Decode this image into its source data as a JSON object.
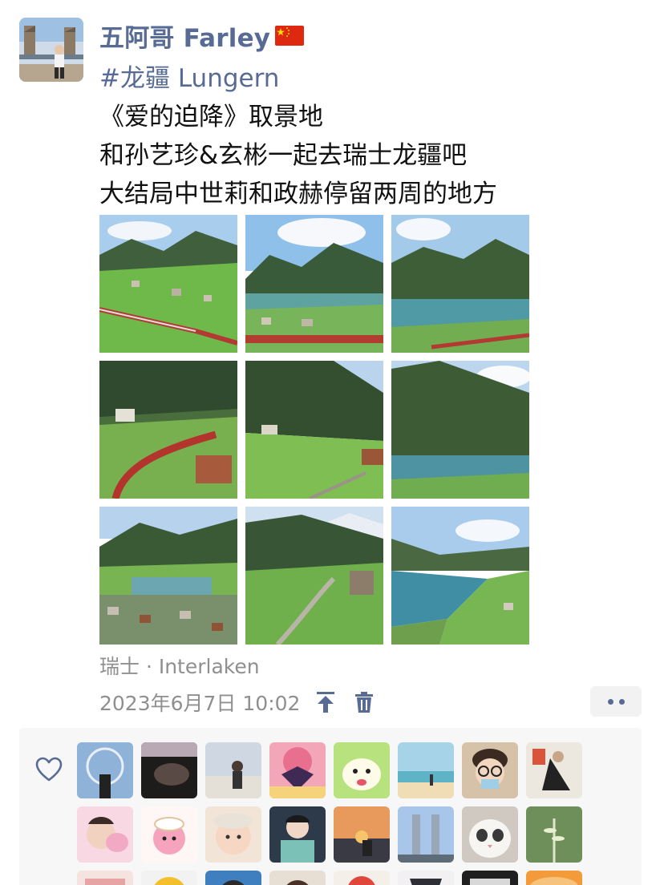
{
  "post": {
    "author": "五阿哥 Farley",
    "flag_icon": "china-flag-icon",
    "hashtag": "#龙疆 Lungern",
    "lines": [
      "《爱的迫降》取景地",
      "和孙艺珍&玄彬一起去瑞士龙疆吧",
      "大结局中世莉和政赫停留两周的地方"
    ],
    "location": "瑞士 · Interlaken",
    "timestamp": "2023年6月7日 10:02",
    "actions": {
      "pin_icon": "pin-to-top-icon",
      "delete_icon": "trash-icon",
      "more_icon": "more-dots-icon"
    },
    "photo_count": 9
  },
  "likes": {
    "heart_icon": "heart-outline-icon",
    "liker_count_visible": 24
  },
  "colors": {
    "link": "#576b95",
    "muted": "#8f8f8f",
    "panel": "#f7f7f7"
  }
}
